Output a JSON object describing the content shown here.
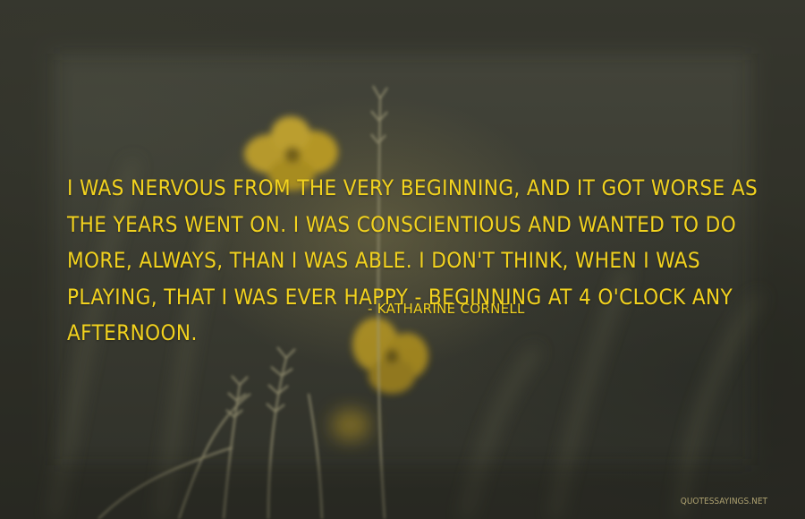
{
  "quote": {
    "text": "I was nervous from the very beginning, and it got worse as the years went on. I was conscientious and wanted to do more, always, than I was able. I don't think, when I was playing, that I was ever happy - beginning at 4 o'clock any afternoon.",
    "author": "- Katharine Cornell"
  },
  "watermark": "QUOTESSAYINGS.NET",
  "colors": {
    "text": "#f2d21e",
    "background": "#3b3c32",
    "flower": "#c9a81e"
  },
  "background_subject": "blurred meadow grasses with yellow wildflowers"
}
